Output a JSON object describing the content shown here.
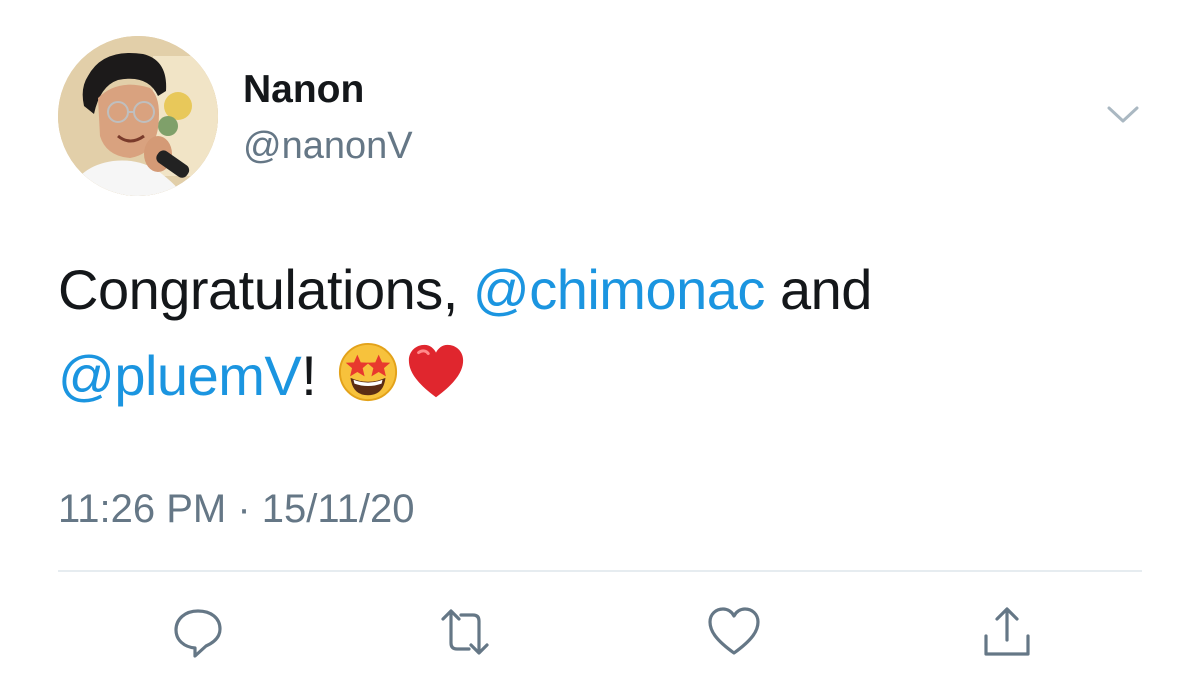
{
  "user": {
    "display_name": "Nanon",
    "handle": "@nanonV",
    "avatar_icon": "profile-photo"
  },
  "tweet": {
    "text_before": "Congratulations, ",
    "mention_1": "@chimonac",
    "text_middle": " and",
    "mention_2": "@pluemV",
    "text_after": "! ",
    "emojis": [
      "star-struck-emoji",
      "red-heart-emoji"
    ]
  },
  "meta": {
    "timestamp": "11:26 PM · 15/11/20"
  },
  "actions": {
    "reply_icon": "reply-icon",
    "retweet_icon": "retweet-icon",
    "like_icon": "heart-icon",
    "share_icon": "share-icon"
  },
  "colors": {
    "mention": "#1b95e0",
    "secondary_text": "#657786",
    "icon": "#657786",
    "divider": "#e6ecf0"
  }
}
